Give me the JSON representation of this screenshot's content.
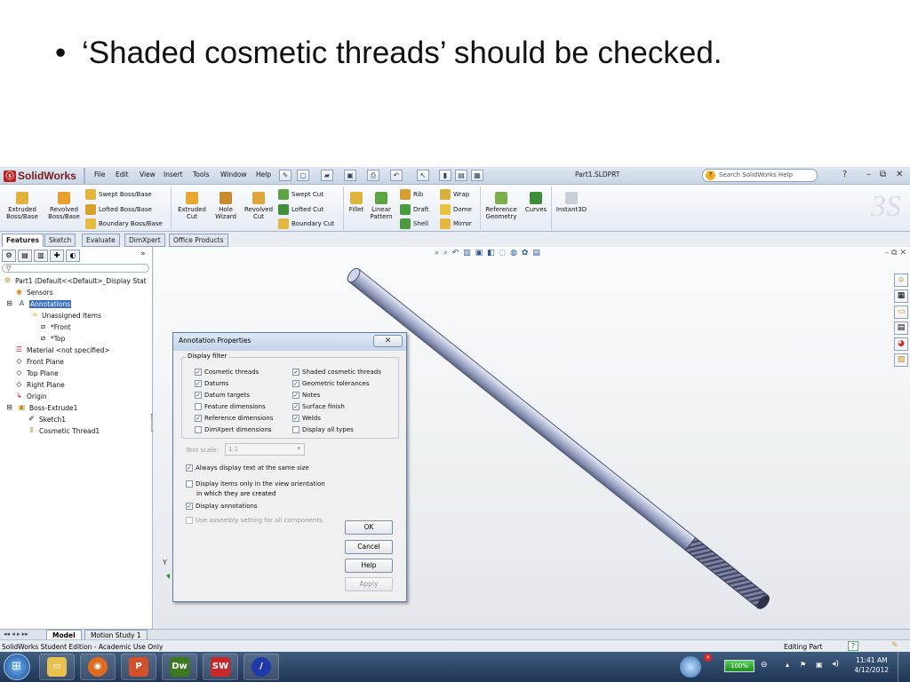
{
  "slide": {
    "bullet_symbol": "•",
    "bullet_text": "‘Shaded cosmetic threads’ should be checked."
  },
  "app": {
    "name": "SolidWorks",
    "menus": [
      "File",
      "Edit",
      "View",
      "Insert",
      "Tools",
      "Window",
      "Help"
    ],
    "document_title": "Part1.SLDPRT",
    "search_placeholder": "Search SolidWorks Help",
    "help_label": "?"
  },
  "commands": {
    "extruded_boss": "Extruded Boss/Base",
    "revolved_boss": "Revolved Boss/Base",
    "swept_boss": "Swept Boss/Base",
    "lofted_boss": "Lofted Boss/Base",
    "boundary_boss": "Boundary Boss/Base",
    "extruded_cut": "Extruded Cut",
    "hole_wizard": "Hole Wizard",
    "revolved_cut": "Revolved Cut",
    "swept_cut": "Swept Cut",
    "lofted_cut": "Lofted Cut",
    "boundary_cut": "Boundary Cut",
    "fillet": "Fillet",
    "linear_pattern": "Linear Pattern",
    "rib": "Rib",
    "draft": "Draft",
    "shell": "Shell",
    "wrap": "Wrap",
    "dome": "Dome",
    "mirror": "Mirror",
    "reference_geometry": "Reference Geometry",
    "curves": "Curves",
    "instant3d": "Instant3D"
  },
  "tabs": [
    "Features",
    "Sketch",
    "Evaluate",
    "DimXpert",
    "Office Products"
  ],
  "tree": {
    "part": "Part1  (Default<<Default>_Display Stat",
    "sensors": "Sensors",
    "annotations": "Annotations",
    "unassigned": "Unassigned Items",
    "front_view": "*Front",
    "top_view": "*Top",
    "material": "Material <not specified>",
    "front_plane": "Front Plane",
    "top_plane": "Top Plane",
    "right_plane": "Right Plane",
    "origin": "Origin",
    "boss_extrude": "Boss-Extrude1",
    "sketch": "Sketch1",
    "cosmetic_thread": "Cosmetic Thread1"
  },
  "dialog": {
    "title": "Annotation Properties",
    "close_label": "✕",
    "group_label": "Display filter",
    "filters_left": [
      {
        "label": "Cosmetic threads",
        "checked": true
      },
      {
        "label": "Datums",
        "checked": true
      },
      {
        "label": "Datum targets",
        "checked": true
      },
      {
        "label": "Feature dimensions",
        "checked": false
      },
      {
        "label": "Reference dimensions",
        "checked": true
      },
      {
        "label": "DimXpert dimensions",
        "checked": false
      }
    ],
    "filters_right": [
      {
        "label": "Shaded cosmetic threads",
        "checked": true
      },
      {
        "label": "Geometric tolerances",
        "checked": true
      },
      {
        "label": "Notes",
        "checked": true
      },
      {
        "label": "Surface finish",
        "checked": true
      },
      {
        "label": "Welds",
        "checked": true
      },
      {
        "label": "Display all types",
        "checked": false
      }
    ],
    "text_scale_label": "Text scale:",
    "text_scale_value": "1:1",
    "opt_same_size": "Always display text at the same size",
    "opt_view_orient_1": "Display items only in the view orientation",
    "opt_view_orient_2": "in which they are created",
    "opt_display_annotations": "Display annotations",
    "opt_assembly": "Use assembly setting for all components",
    "ok": "OK",
    "cancel": "Cancel",
    "help": "Help",
    "apply": "Apply"
  },
  "bottom_tabs": [
    "Model",
    "Motion Study 1"
  ],
  "status": {
    "left": "SolidWorks Student Edition - Academic Use Only",
    "mode": "Editing Part",
    "help": "?"
  },
  "taskbar": {
    "battery": "100%",
    "time": "11:41 AM",
    "date": "4/12/2012",
    "dw_label": "Dw",
    "sw_label": "SW"
  },
  "colors": {
    "accent": "#3a6fc4",
    "rod": "#9fa8c8"
  }
}
